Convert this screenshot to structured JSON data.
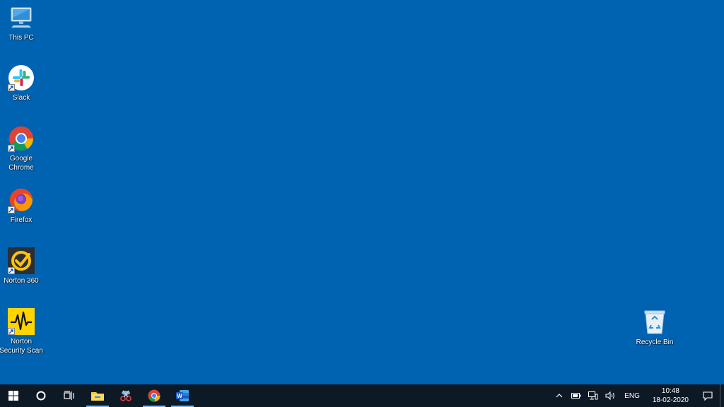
{
  "desktop": {
    "background": "#0063b1",
    "icons": [
      {
        "label": "This PC",
        "icon": "this-pc-icon"
      },
      {
        "label": "Slack",
        "icon": "slack-icon"
      },
      {
        "label": "Google Chrome",
        "icon": "chrome-icon"
      },
      {
        "label": "Firefox",
        "icon": "firefox-icon"
      },
      {
        "label": "Norton 360",
        "icon": "norton-360-icon"
      },
      {
        "label": "Norton Security Scan",
        "icon": "norton-security-scan-icon"
      },
      {
        "label": "Recycle Bin",
        "icon": "recycle-bin-icon"
      }
    ]
  },
  "taskbar": {
    "pinned": [
      {
        "name": "start",
        "icon": "windows-logo-icon"
      },
      {
        "name": "search",
        "icon": "cortana-circle-icon"
      },
      {
        "name": "task-view",
        "icon": "task-view-icon"
      },
      {
        "name": "file-explorer",
        "icon": "folder-icon"
      },
      {
        "name": "snipping-tool",
        "icon": "scissors-icon"
      },
      {
        "name": "chrome",
        "icon": "chrome-icon"
      },
      {
        "name": "word",
        "icon": "word-icon"
      }
    ],
    "tray": {
      "language": "ENG",
      "time": "10:48",
      "date": "18-02-2020"
    }
  }
}
